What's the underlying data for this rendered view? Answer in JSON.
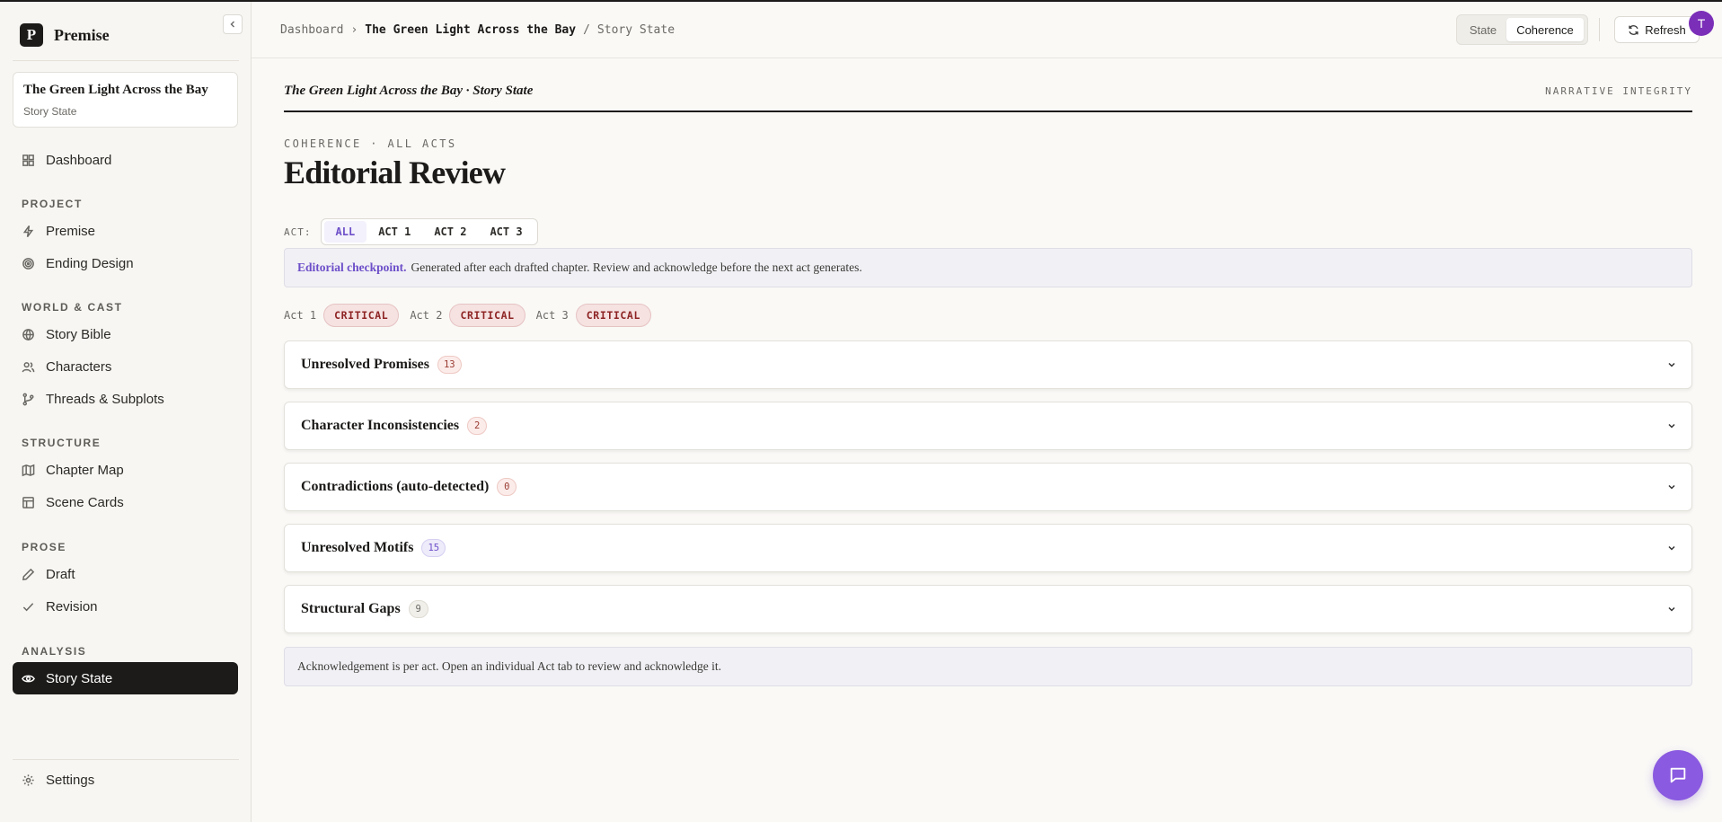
{
  "brand": {
    "name": "Premise",
    "logo_letter": "P"
  },
  "project": {
    "title": "The Green Light Across the Bay",
    "subtitle": "Story State"
  },
  "nav": {
    "dashboard": "Dashboard",
    "sections": [
      {
        "label": "PROJECT",
        "items": [
          "Premise",
          "Ending Design"
        ]
      },
      {
        "label": "WORLD & CAST",
        "items": [
          "Story Bible",
          "Characters",
          "Threads & Subplots"
        ]
      },
      {
        "label": "STRUCTURE",
        "items": [
          "Chapter Map",
          "Scene Cards"
        ]
      },
      {
        "label": "PROSE",
        "items": [
          "Draft",
          "Revision"
        ]
      },
      {
        "label": "ANALYSIS",
        "items": [
          "Story State"
        ]
      }
    ],
    "settings": "Settings"
  },
  "topbar": {
    "breadcrumb": [
      "Dashboard",
      "›",
      "The Green Light Across the Bay",
      "/",
      "Story State"
    ],
    "view_toggle": [
      "State",
      "Coherence"
    ],
    "selected_view": "Coherence",
    "refresh_label": "Refresh",
    "avatar_letter": "T"
  },
  "masthead": {
    "title": "The Green Light Across the Bay · Story State",
    "right": "NARRATIVE INTEGRITY"
  },
  "header": {
    "kicker": "COHERENCE · ALL ACTS",
    "title": "Editorial Review"
  },
  "act_filter": {
    "label": "ACT:",
    "tabs": [
      "ALL",
      "ACT 1",
      "ACT 2",
      "ACT 3"
    ],
    "selected": "ALL"
  },
  "checkpoint": {
    "bold": "Editorial checkpoint.",
    "text": "Generated after each drafted chapter. Review and acknowledge before the next act generates."
  },
  "severity": [
    {
      "act": "Act 1",
      "level": "CRITICAL"
    },
    {
      "act": "Act 2",
      "level": "CRITICAL"
    },
    {
      "act": "Act 3",
      "level": "CRITICAL"
    }
  ],
  "sections": [
    {
      "title": "Unresolved Promises",
      "count": "13"
    },
    {
      "title": "Character Inconsistencies",
      "count": "2"
    },
    {
      "title": "Contradictions (auto-detected)",
      "count": "0"
    },
    {
      "title": "Unresolved Motifs",
      "count": "15"
    },
    {
      "title": "Structural Gaps",
      "count": "9"
    }
  ],
  "footer_note": "Acknowledgement is per act. Open an individual Act tab to review and acknowledge it.",
  "colors": {
    "accent": "#6d4fc9",
    "critical": "#8e2424",
    "fab": "#8a5ae0",
    "avatar": "#7b2fb8"
  }
}
